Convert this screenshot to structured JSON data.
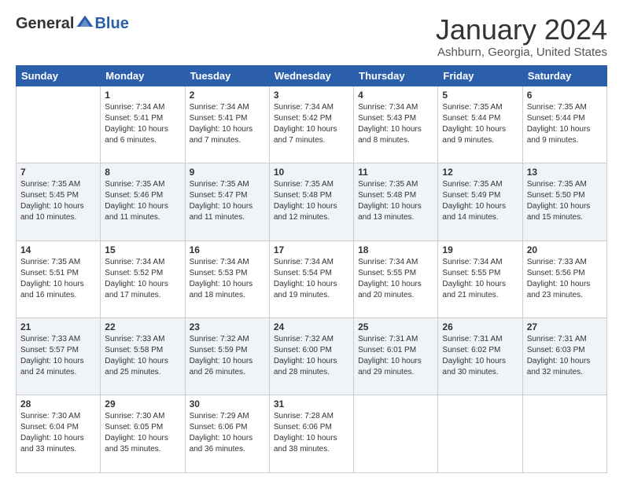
{
  "header": {
    "logo": {
      "general": "General",
      "blue": "Blue",
      "logo_alt": "GeneralBlue logo"
    },
    "title": "January 2024",
    "location": "Ashburn, Georgia, United States"
  },
  "days_of_week": [
    "Sunday",
    "Monday",
    "Tuesday",
    "Wednesday",
    "Thursday",
    "Friday",
    "Saturday"
  ],
  "weeks": [
    [
      {
        "day": "",
        "info": ""
      },
      {
        "day": "1",
        "info": "Sunrise: 7:34 AM\nSunset: 5:41 PM\nDaylight: 10 hours\nand 6 minutes."
      },
      {
        "day": "2",
        "info": "Sunrise: 7:34 AM\nSunset: 5:41 PM\nDaylight: 10 hours\nand 7 minutes."
      },
      {
        "day": "3",
        "info": "Sunrise: 7:34 AM\nSunset: 5:42 PM\nDaylight: 10 hours\nand 7 minutes."
      },
      {
        "day": "4",
        "info": "Sunrise: 7:34 AM\nSunset: 5:43 PM\nDaylight: 10 hours\nand 8 minutes."
      },
      {
        "day": "5",
        "info": "Sunrise: 7:35 AM\nSunset: 5:44 PM\nDaylight: 10 hours\nand 9 minutes."
      },
      {
        "day": "6",
        "info": "Sunrise: 7:35 AM\nSunset: 5:44 PM\nDaylight: 10 hours\nand 9 minutes."
      }
    ],
    [
      {
        "day": "7",
        "info": "Sunrise: 7:35 AM\nSunset: 5:45 PM\nDaylight: 10 hours\nand 10 minutes."
      },
      {
        "day": "8",
        "info": "Sunrise: 7:35 AM\nSunset: 5:46 PM\nDaylight: 10 hours\nand 11 minutes."
      },
      {
        "day": "9",
        "info": "Sunrise: 7:35 AM\nSunset: 5:47 PM\nDaylight: 10 hours\nand 11 minutes."
      },
      {
        "day": "10",
        "info": "Sunrise: 7:35 AM\nSunset: 5:48 PM\nDaylight: 10 hours\nand 12 minutes."
      },
      {
        "day": "11",
        "info": "Sunrise: 7:35 AM\nSunset: 5:48 PM\nDaylight: 10 hours\nand 13 minutes."
      },
      {
        "day": "12",
        "info": "Sunrise: 7:35 AM\nSunset: 5:49 PM\nDaylight: 10 hours\nand 14 minutes."
      },
      {
        "day": "13",
        "info": "Sunrise: 7:35 AM\nSunset: 5:50 PM\nDaylight: 10 hours\nand 15 minutes."
      }
    ],
    [
      {
        "day": "14",
        "info": "Sunrise: 7:35 AM\nSunset: 5:51 PM\nDaylight: 10 hours\nand 16 minutes."
      },
      {
        "day": "15",
        "info": "Sunrise: 7:34 AM\nSunset: 5:52 PM\nDaylight: 10 hours\nand 17 minutes."
      },
      {
        "day": "16",
        "info": "Sunrise: 7:34 AM\nSunset: 5:53 PM\nDaylight: 10 hours\nand 18 minutes."
      },
      {
        "day": "17",
        "info": "Sunrise: 7:34 AM\nSunset: 5:54 PM\nDaylight: 10 hours\nand 19 minutes."
      },
      {
        "day": "18",
        "info": "Sunrise: 7:34 AM\nSunset: 5:55 PM\nDaylight: 10 hours\nand 20 minutes."
      },
      {
        "day": "19",
        "info": "Sunrise: 7:34 AM\nSunset: 5:55 PM\nDaylight: 10 hours\nand 21 minutes."
      },
      {
        "day": "20",
        "info": "Sunrise: 7:33 AM\nSunset: 5:56 PM\nDaylight: 10 hours\nand 23 minutes."
      }
    ],
    [
      {
        "day": "21",
        "info": "Sunrise: 7:33 AM\nSunset: 5:57 PM\nDaylight: 10 hours\nand 24 minutes."
      },
      {
        "day": "22",
        "info": "Sunrise: 7:33 AM\nSunset: 5:58 PM\nDaylight: 10 hours\nand 25 minutes."
      },
      {
        "day": "23",
        "info": "Sunrise: 7:32 AM\nSunset: 5:59 PM\nDaylight: 10 hours\nand 26 minutes."
      },
      {
        "day": "24",
        "info": "Sunrise: 7:32 AM\nSunset: 6:00 PM\nDaylight: 10 hours\nand 28 minutes."
      },
      {
        "day": "25",
        "info": "Sunrise: 7:31 AM\nSunset: 6:01 PM\nDaylight: 10 hours\nand 29 minutes."
      },
      {
        "day": "26",
        "info": "Sunrise: 7:31 AM\nSunset: 6:02 PM\nDaylight: 10 hours\nand 30 minutes."
      },
      {
        "day": "27",
        "info": "Sunrise: 7:31 AM\nSunset: 6:03 PM\nDaylight: 10 hours\nand 32 minutes."
      }
    ],
    [
      {
        "day": "28",
        "info": "Sunrise: 7:30 AM\nSunset: 6:04 PM\nDaylight: 10 hours\nand 33 minutes."
      },
      {
        "day": "29",
        "info": "Sunrise: 7:30 AM\nSunset: 6:05 PM\nDaylight: 10 hours\nand 35 minutes."
      },
      {
        "day": "30",
        "info": "Sunrise: 7:29 AM\nSunset: 6:06 PM\nDaylight: 10 hours\nand 36 minutes."
      },
      {
        "day": "31",
        "info": "Sunrise: 7:28 AM\nSunset: 6:06 PM\nDaylight: 10 hours\nand 38 minutes."
      },
      {
        "day": "",
        "info": ""
      },
      {
        "day": "",
        "info": ""
      },
      {
        "day": "",
        "info": ""
      }
    ]
  ]
}
